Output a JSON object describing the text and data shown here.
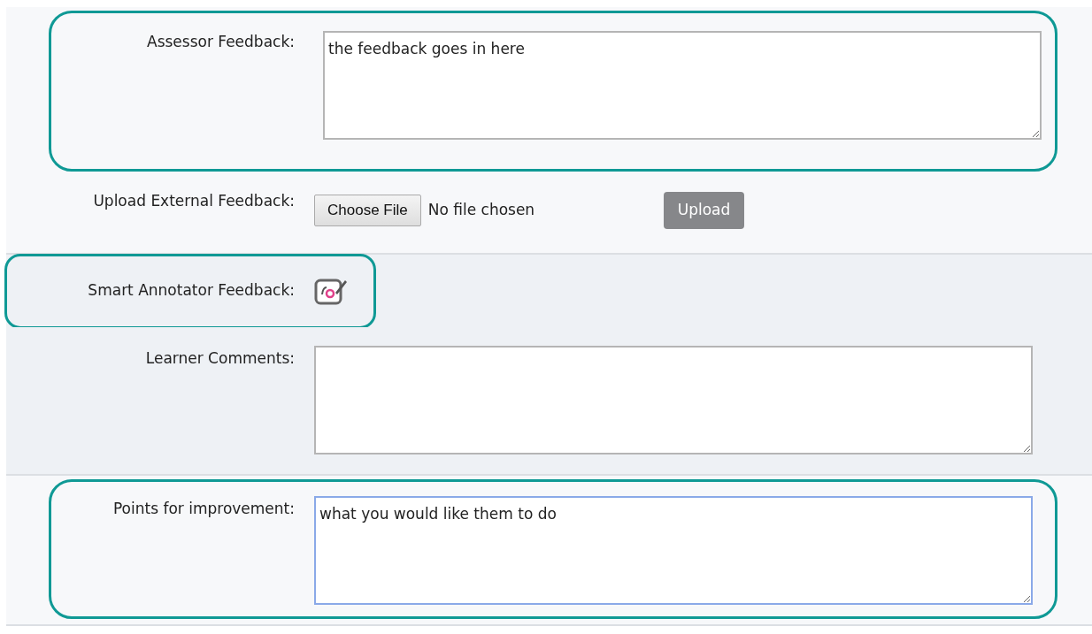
{
  "rows": [
    {
      "kind": "textarea",
      "label": "Assessor Feedback:",
      "value": "the feedback goes in here",
      "highlighted": true,
      "focused": false,
      "shaded": false
    },
    {
      "kind": "upload",
      "label": "Upload External Feedback:",
      "choose_label": "Choose File",
      "file_status": "No file chosen",
      "button": "Upload",
      "shaded": false
    },
    {
      "kind": "annotator",
      "label": "Smart Annotator Feedback:",
      "highlighted": true,
      "shaded": true
    },
    {
      "kind": "textarea",
      "label": "Learner Comments:",
      "value": "",
      "highlighted": false,
      "focused": false,
      "shaded": true
    },
    {
      "kind": "textarea",
      "label": "Points for improvement:",
      "value": "what you would like them to do ",
      "highlighted": true,
      "focused": true,
      "shaded": false
    }
  ]
}
